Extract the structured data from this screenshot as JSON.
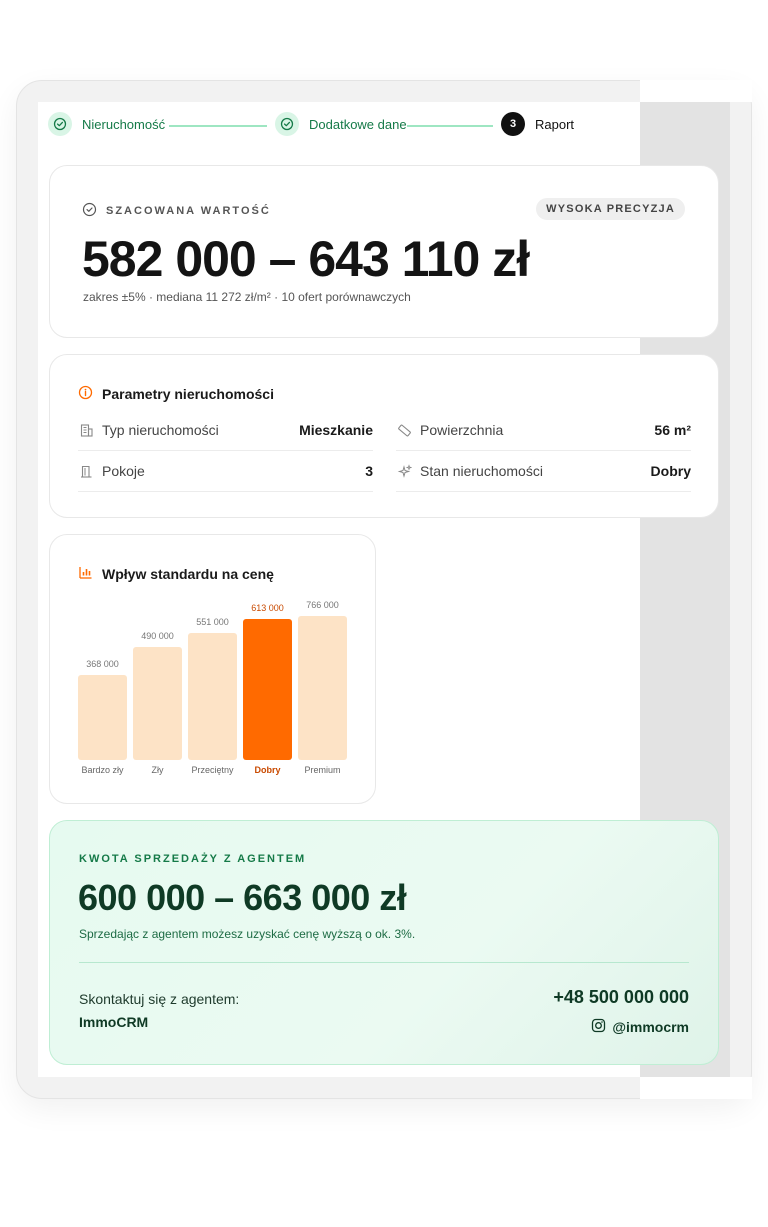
{
  "stepper": {
    "steps": [
      {
        "label": "Nieruchomość",
        "state": "done"
      },
      {
        "label": "Dodatkowe dane",
        "state": "done"
      },
      {
        "label": "Raport",
        "state": "active",
        "number": "3"
      }
    ]
  },
  "valuation": {
    "eyebrow": "SZACOWANA WARTOŚĆ",
    "badge": "WYSOKA PRECYZJA",
    "range": "582 000 – 643 110 zł",
    "details": "zakres ±5% · mediana 11 272 zł/m² · 10 ofert porównawczych"
  },
  "parameters": {
    "title": "Parametry nieruchomości",
    "rows": [
      {
        "icon": "building-icon",
        "label": "Typ nieruchomości",
        "value": "Mieszkanie"
      },
      {
        "icon": "ruler-icon",
        "label": "Powierzchnia",
        "value": "56 m²"
      },
      {
        "icon": "door-icon",
        "label": "Pokoje",
        "value": "3"
      },
      {
        "icon": "sparkles-icon",
        "label": "Stan nieruchomości",
        "value": "Dobry"
      }
    ]
  },
  "chart": {
    "title": "Wpływ standardu na cenę"
  },
  "chart_data": {
    "type": "bar",
    "title": "Wpływ standardu na cenę",
    "categories": [
      "Bardzo zły",
      "Zły",
      "Przeciętny",
      "Dobry",
      "Premium"
    ],
    "values": [
      368000,
      490000,
      551000,
      613000,
      766000
    ],
    "value_labels": [
      "368 000",
      "490 000",
      "551 000",
      "613 000",
      "766 000"
    ],
    "highlighted_category": "Dobry",
    "xlabel": "",
    "ylabel": "",
    "ylim": [
      0,
      800000
    ],
    "grid": false,
    "colors": {
      "default": "#fde3c6",
      "highlight": "#ff6a00",
      "highlight_text": "#c94a00"
    }
  },
  "agent": {
    "eyebrow": "KWOTA SPRZEDAŻY Z AGENTEM",
    "range": "600 000 – 663 000 zł",
    "note": "Sprzedając z agentem możesz uzyskać cenę wyższą o ok. 3%.",
    "contact_label": "Skontaktuj się z agentem:",
    "company": "ImmoCRM",
    "phone": "+48 500 000 000",
    "instagram": "@immocrm"
  },
  "colors": {
    "accent_green": "#157a48",
    "accent_orange": "#ff6a00",
    "dark": "#111111"
  }
}
